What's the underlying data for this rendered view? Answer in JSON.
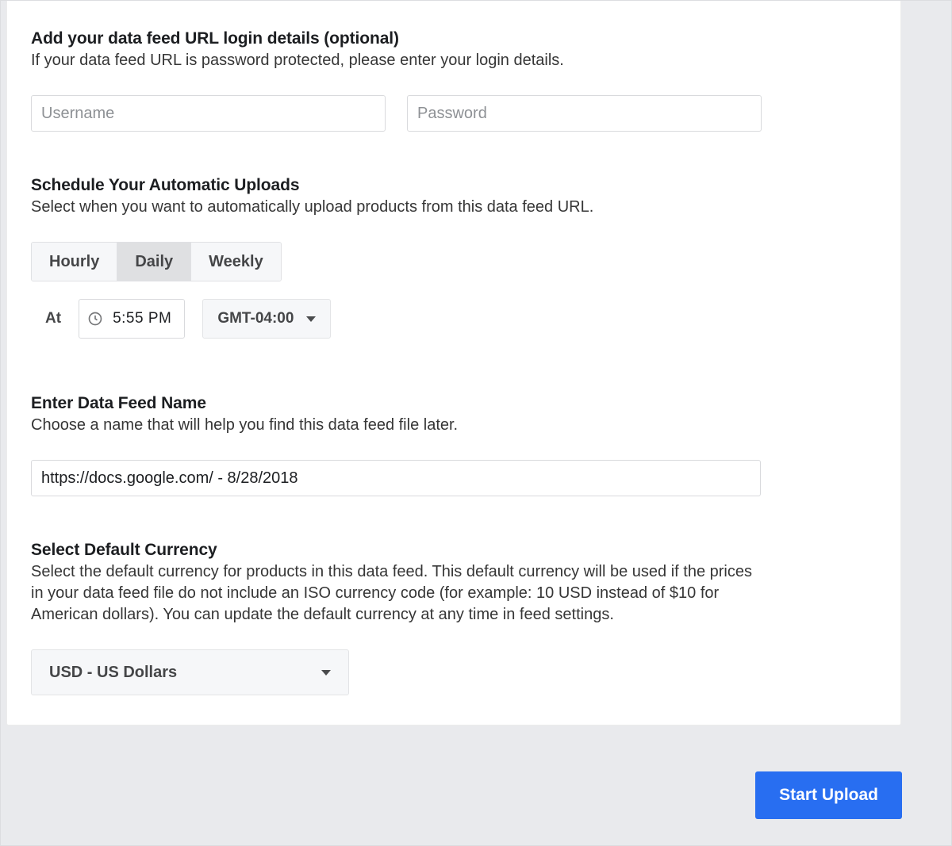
{
  "login": {
    "title": "Add your data feed URL login details (optional)",
    "desc": "If your data feed URL is password protected, please enter your login details.",
    "username_placeholder": "Username",
    "password_placeholder": "Password"
  },
  "schedule": {
    "title": "Schedule Your Automatic Uploads",
    "desc": "Select when you want to automatically upload products from this data feed URL.",
    "segments": {
      "hourly": "Hourly",
      "daily": "Daily",
      "weekly": "Weekly"
    },
    "at_label": "At",
    "time": "5:55 PM",
    "timezone": "GMT-04:00"
  },
  "feed_name": {
    "title": "Enter Data Feed Name",
    "desc": "Choose a name that will help you find this data feed file later.",
    "value": "https://docs.google.com/ - 8/28/2018"
  },
  "currency": {
    "title": "Select Default Currency",
    "desc": "Select the default currency for products in this data feed. This default currency will be used if the prices in your data feed file do not include an ISO currency code (for example: 10 USD instead of $10 for American dollars). You can update the default currency at any time in feed settings.",
    "selected": "USD - US Dollars"
  },
  "footer": {
    "start_upload": "Start Upload"
  }
}
